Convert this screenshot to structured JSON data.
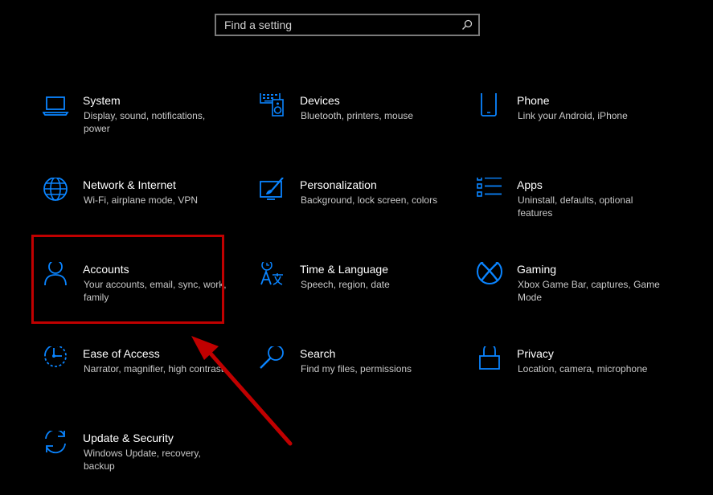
{
  "search": {
    "placeholder": "Find a setting",
    "icon": "search-icon"
  },
  "accent": "#0a84ff",
  "tiles": [
    {
      "title": "System",
      "desc": "Display, sound, notifications, power",
      "icon": "laptop-icon"
    },
    {
      "title": "Devices",
      "desc": "Bluetooth, printers, mouse",
      "icon": "keyboard-speaker-icon"
    },
    {
      "title": "Phone",
      "desc": "Link your Android, iPhone",
      "icon": "phone-icon"
    },
    {
      "title": "Network & Internet",
      "desc": "Wi-Fi, airplane mode, VPN",
      "icon": "globe-icon"
    },
    {
      "title": "Personalization",
      "desc": "Background, lock screen, colors",
      "icon": "paintbrush-icon"
    },
    {
      "title": "Apps",
      "desc": "Uninstall, defaults, optional features",
      "icon": "apps-list-icon"
    },
    {
      "title": "Accounts",
      "desc": "Your accounts, email, sync, work, family",
      "icon": "person-icon"
    },
    {
      "title": "Time & Language",
      "desc": "Speech, region, date",
      "icon": "time-language-icon"
    },
    {
      "title": "Gaming",
      "desc": "Xbox Game Bar, captures, Game Mode",
      "icon": "xbox-icon"
    },
    {
      "title": "Ease of Access",
      "desc": "Narrator, magnifier, high contrast",
      "icon": "ease-of-access-icon"
    },
    {
      "title": "Search",
      "desc": "Find my files, permissions",
      "icon": "magnifier-icon"
    },
    {
      "title": "Privacy",
      "desc": "Location, camera, microphone",
      "icon": "lock-icon"
    },
    {
      "title": "Update & Security",
      "desc": "Windows Update, recovery, backup",
      "icon": "sync-icon"
    }
  ],
  "annotation": {
    "highlight_color": "#c00000",
    "arrow_color": "#c00000"
  }
}
